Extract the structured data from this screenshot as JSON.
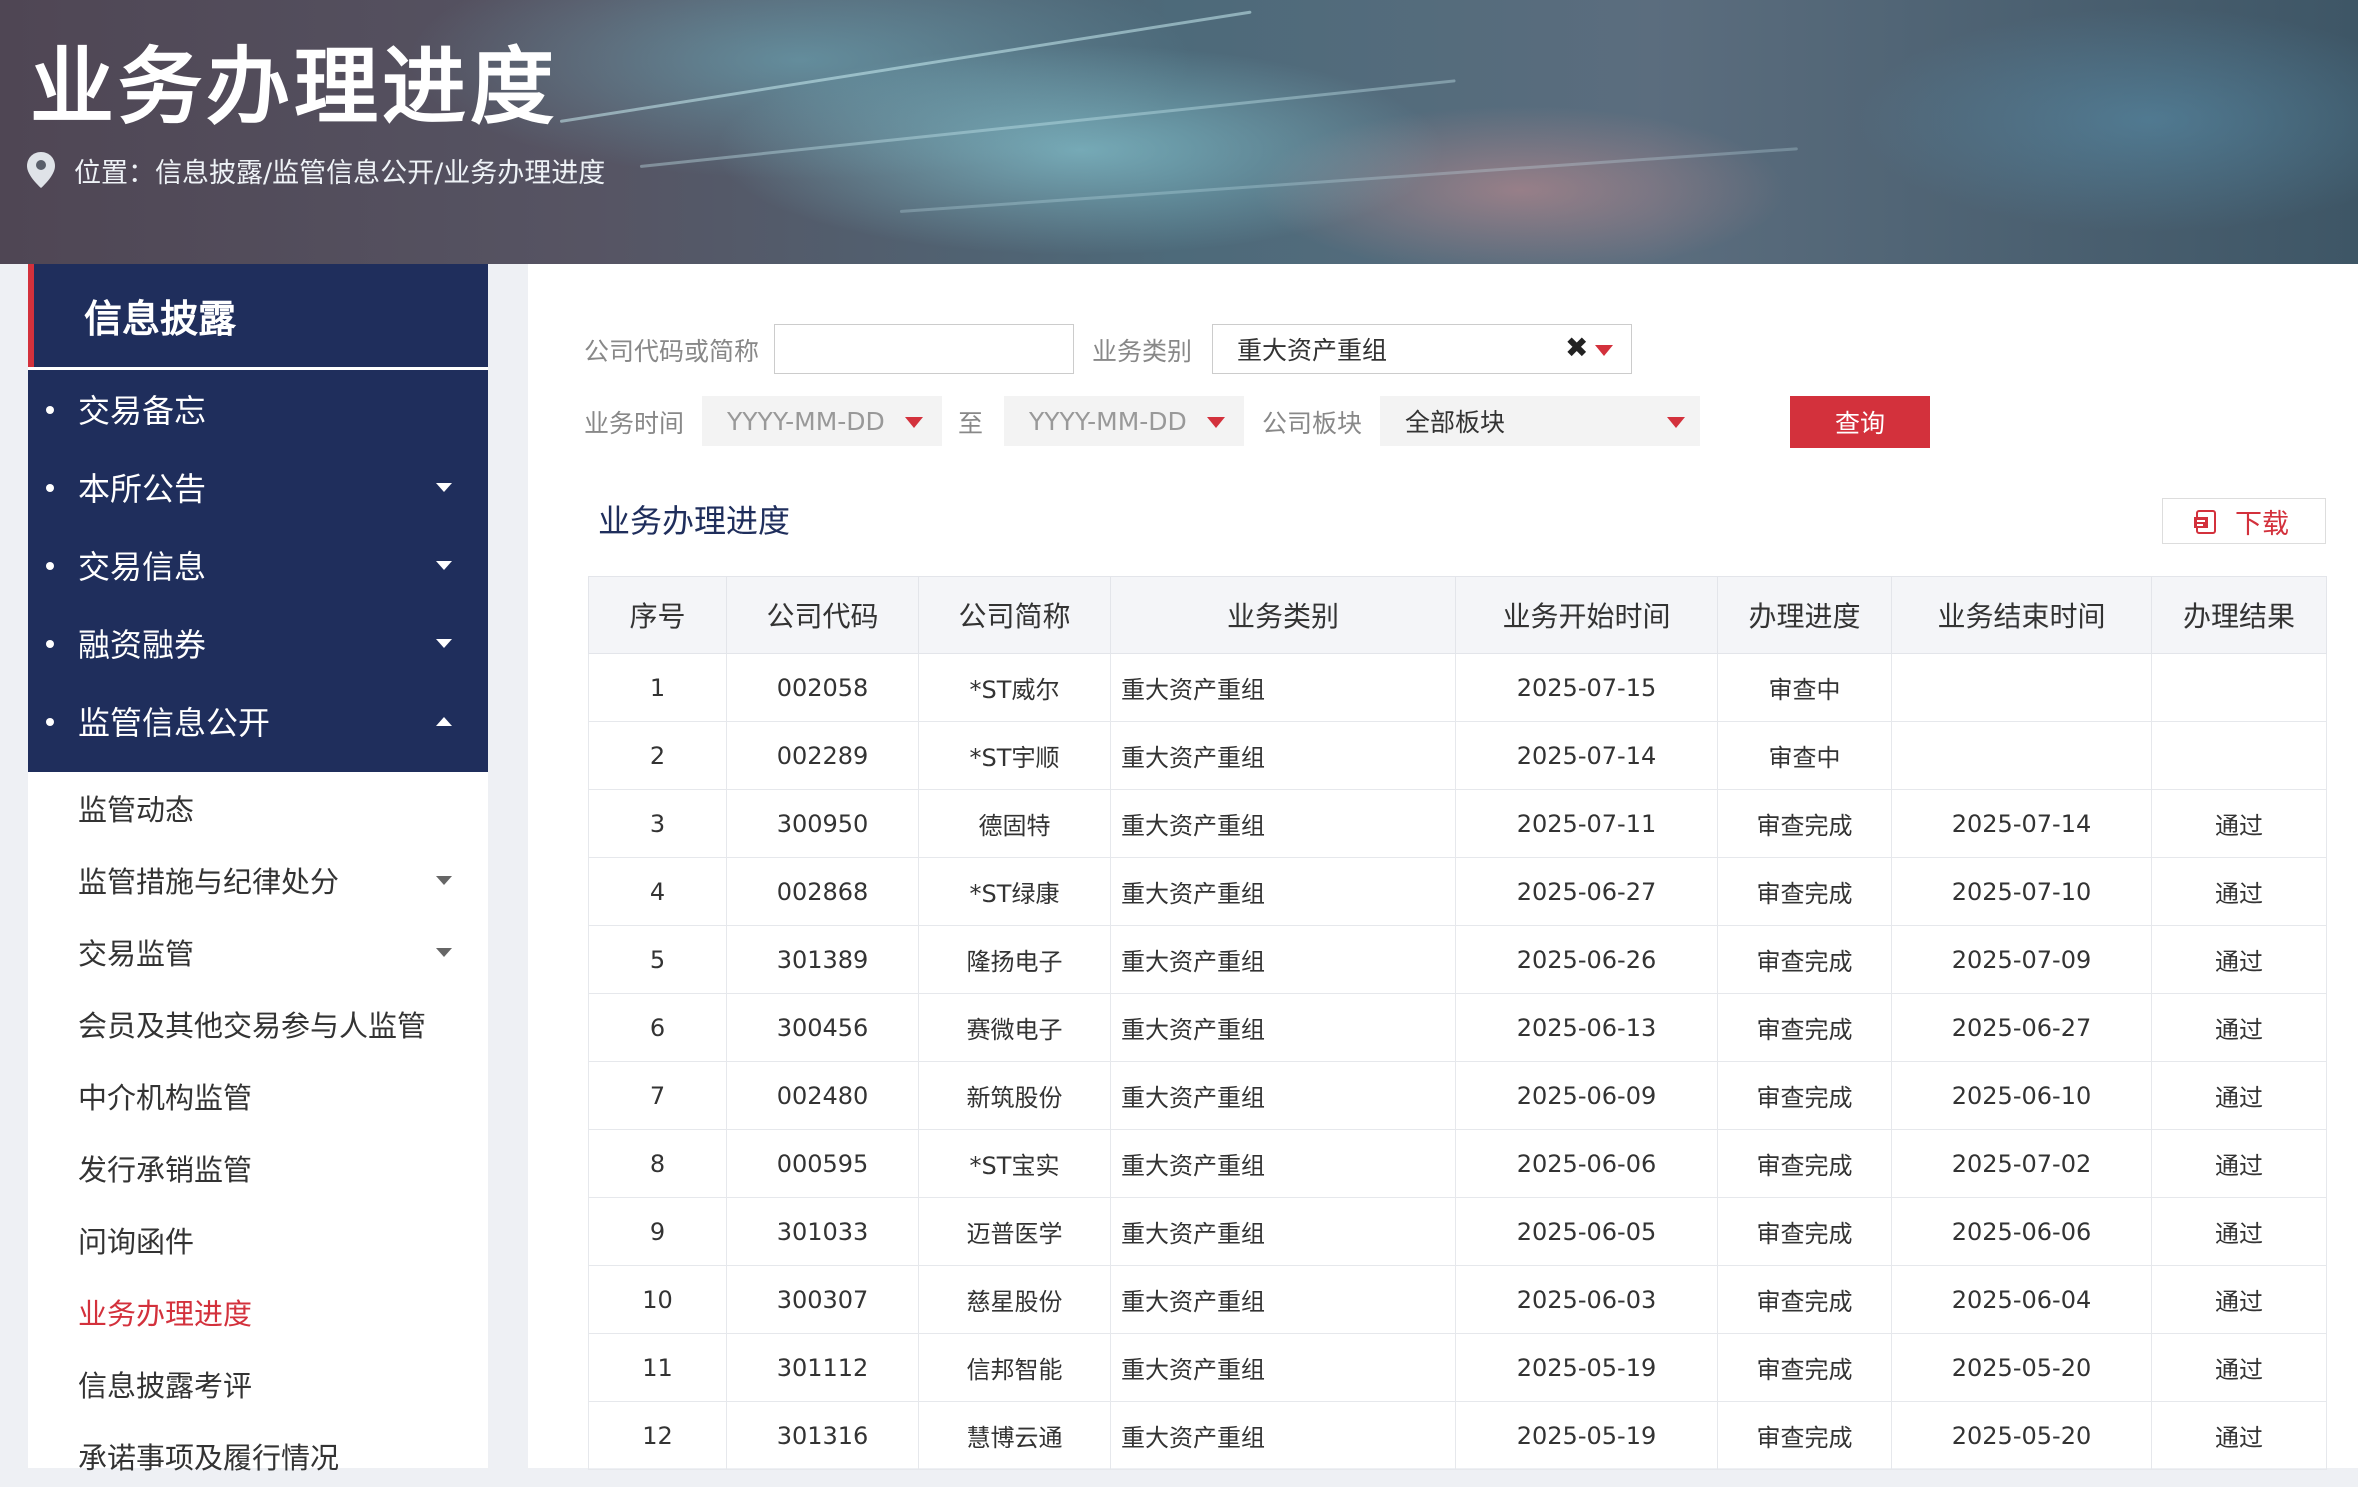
{
  "header": {
    "title": "业务办理进度",
    "location_label": "位置：",
    "location_path": "信息披露/监管信息公开/业务办理进度"
  },
  "sidebar": {
    "heading": "信息披露",
    "nav": [
      {
        "label": "交易备忘",
        "caret": "none"
      },
      {
        "label": "本所公告",
        "caret": "down"
      },
      {
        "label": "交易信息",
        "caret": "down"
      },
      {
        "label": "融资融券",
        "caret": "down"
      },
      {
        "label": "监管信息公开",
        "caret": "up"
      }
    ],
    "sub": [
      {
        "label": "监管动态",
        "caret": "none"
      },
      {
        "label": "监管措施与纪律处分",
        "caret": "down"
      },
      {
        "label": "交易监管",
        "caret": "down"
      },
      {
        "label": "会员及其他交易参与人监管",
        "caret": "none"
      },
      {
        "label": "中介机构监管",
        "caret": "none"
      },
      {
        "label": "发行承销监管",
        "caret": "none"
      },
      {
        "label": "问询函件",
        "caret": "none"
      },
      {
        "label": "业务办理进度",
        "caret": "none",
        "active": true
      },
      {
        "label": "信息披露考评",
        "caret": "none"
      },
      {
        "label": "承诺事项及履行情况",
        "caret": "none"
      }
    ]
  },
  "filters": {
    "company_label": "公司代码或简称",
    "company_value": "",
    "biz_type_label": "业务类别",
    "biz_type_value": "重大资产重组",
    "clear_icon": "✖",
    "time_label": "业务时间",
    "date_from_placeholder": "YYYY-MM-DD",
    "to_label": "至",
    "date_to_placeholder": "YYYY-MM-DD",
    "board_label": "公司板块",
    "board_value": "全部板块",
    "query_label": "查询"
  },
  "section": {
    "title": "业务办理进度",
    "download_label": "下载"
  },
  "table": {
    "columns": [
      "序号",
      "公司代码",
      "公司简称",
      "业务类别",
      "业务开始时间",
      "办理进度",
      "业务结束时间",
      "办理结果"
    ],
    "rows": [
      [
        "1",
        "002058",
        "*ST威尔",
        "重大资产重组",
        "2025-07-15",
        "审查中",
        "",
        ""
      ],
      [
        "2",
        "002289",
        "*ST宇顺",
        "重大资产重组",
        "2025-07-14",
        "审查中",
        "",
        ""
      ],
      [
        "3",
        "300950",
        "德固特",
        "重大资产重组",
        "2025-07-11",
        "审查完成",
        "2025-07-14",
        "通过"
      ],
      [
        "4",
        "002868",
        "*ST绿康",
        "重大资产重组",
        "2025-06-27",
        "审查完成",
        "2025-07-10",
        "通过"
      ],
      [
        "5",
        "301389",
        "隆扬电子",
        "重大资产重组",
        "2025-06-26",
        "审查完成",
        "2025-07-09",
        "通过"
      ],
      [
        "6",
        "300456",
        "赛微电子",
        "重大资产重组",
        "2025-06-13",
        "审查完成",
        "2025-06-27",
        "通过"
      ],
      [
        "7",
        "002480",
        "新筑股份",
        "重大资产重组",
        "2025-06-09",
        "审查完成",
        "2025-06-10",
        "通过"
      ],
      [
        "8",
        "000595",
        "*ST宝实",
        "重大资产重组",
        "2025-06-06",
        "审查完成",
        "2025-07-02",
        "通过"
      ],
      [
        "9",
        "301033",
        "迈普医学",
        "重大资产重组",
        "2025-06-05",
        "审查完成",
        "2025-06-06",
        "通过"
      ],
      [
        "10",
        "300307",
        "慈星股份",
        "重大资产重组",
        "2025-06-03",
        "审查完成",
        "2025-06-04",
        "通过"
      ],
      [
        "11",
        "301112",
        "信邦智能",
        "重大资产重组",
        "2025-05-19",
        "审查完成",
        "2025-05-20",
        "通过"
      ],
      [
        "12",
        "301316",
        "慧博云通",
        "重大资产重组",
        "2025-05-19",
        "审查完成",
        "2025-05-20",
        "通过"
      ]
    ]
  },
  "colors": {
    "navy": "#1f2e5c",
    "accent_red": "#d3313c",
    "header_row": "#f4f5f8"
  },
  "icons": {
    "location": "location-pin-icon",
    "download": "pdf-file-icon",
    "caret": "chevron-down-icon"
  }
}
